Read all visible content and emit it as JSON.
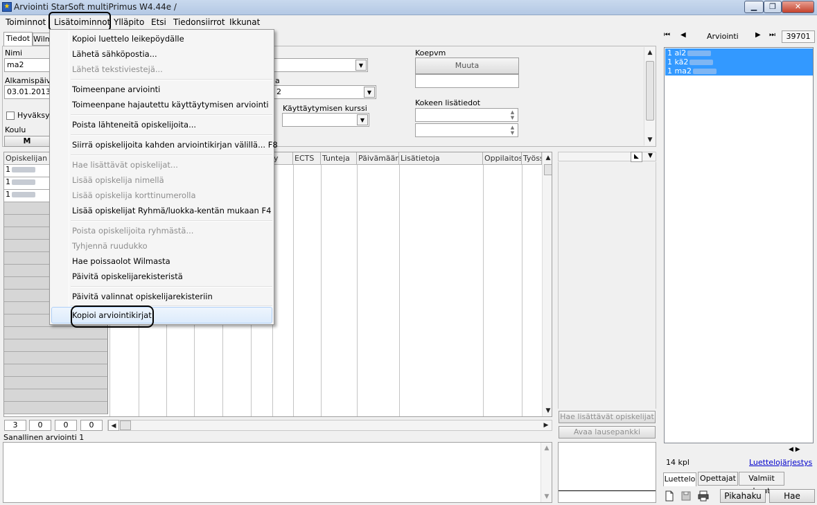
{
  "window": {
    "title": "Arviointi StarSoft multiPrimus W4.44e /",
    "min_label": "▁",
    "max_label": "❐",
    "close_label": "✕"
  },
  "menubar": [
    "Toiminnot",
    "Lisätoiminnot",
    "Ylläpito",
    "Etsi",
    "Tiedonsiirrot",
    "Ikkunat"
  ],
  "tabs": {
    "tiedot": "Tiedot",
    "wilma": "Wilm"
  },
  "form": {
    "nimi_label": "Nimi",
    "nimi_value": "ma2",
    "alkamispaiva_label": "Alkamispäivä",
    "alkamispaiva_value": "03.01.2013",
    "hyvaksytty_label": "Hyväksyt",
    "koulu_label": "Koulu",
    "koulu_btn": "M",
    "partial_label_a": "a",
    "partial_value_a": "2",
    "kayttaytymisen_kurssi_label": "Käyttäytymisen kurssi",
    "koepvm_label": "Koepvm",
    "muuta_button": "Muuta",
    "kokeen_lisatiedot_label": "Kokeen lisätiedot"
  },
  "grid": {
    "first_header": "Opiskelijan ni",
    "headers": [
      "y",
      "ECTS",
      "Tunteja",
      "Päivämäärä",
      "Lisätietoja",
      "Oppilaitos",
      "Työss"
    ],
    "rows": [
      "1",
      "1",
      "1"
    ]
  },
  "counts": [
    "3",
    "0",
    "0",
    "0"
  ],
  "sanallinen_label": "Sanallinen arviointi 1",
  "middle_buttons": {
    "hae": "Hae lisättävät opiskelijat",
    "avaa": "Avaa lausepankki"
  },
  "nav": {
    "first": "⏮",
    "prev": "◀",
    "label": "Arviointi",
    "next": "▶",
    "last": "⏭",
    "number": "39701"
  },
  "right_list": [
    "1 ai2",
    "1 kä2",
    "1 ma2"
  ],
  "list_count": "14 kpl",
  "list_order_link": "Luettelojärjestys",
  "bottom_tabs": [
    "Luettelo",
    "Opettajat",
    "Valmiit haut"
  ],
  "bottom_buttons": {
    "pikahaku": "Pikahaku",
    "hae": "Hae"
  },
  "dropdown": {
    "items": [
      {
        "label": "Kopioi luettelo leikepöydälle",
        "enabled": true
      },
      {
        "label": "Lähetä sähköpostia...",
        "enabled": true
      },
      {
        "label": "Lähetä tekstiviestejä...",
        "enabled": false
      },
      {
        "label": "Toimeenpane arviointi",
        "enabled": true
      },
      {
        "label": "Toimeenpane hajautettu käyttäytymisen arviointi",
        "enabled": true
      },
      {
        "label": "Poista lähteneitä opiskelijoita...",
        "enabled": true
      },
      {
        "label": "Siirrä opiskelijoita kahden arviointikirjan välillä... F8",
        "enabled": true
      },
      {
        "label": "Hae lisättävät opiskelijat...",
        "enabled": false
      },
      {
        "label": "Lisää opiskelija nimellä",
        "enabled": false
      },
      {
        "label": "Lisää opiskelija korttinumerolla",
        "enabled": false
      },
      {
        "label": "Lisää opiskelijat Ryhmä/luokka-kentän mukaan  F4",
        "enabled": true
      },
      {
        "label": "Poista opiskelijoita ryhmästä...",
        "enabled": false
      },
      {
        "label": "Tyhjennä ruudukko",
        "enabled": false
      },
      {
        "label": "Hae poissaolot Wilmasta",
        "enabled": true
      },
      {
        "label": "Päivitä opiskelijarekisteristä",
        "enabled": true
      },
      {
        "label": "Päivitä valinnat opiskelijarekisteriin",
        "enabled": true
      },
      {
        "label": "Kopioi arviointikirjat",
        "enabled": true
      }
    ]
  }
}
